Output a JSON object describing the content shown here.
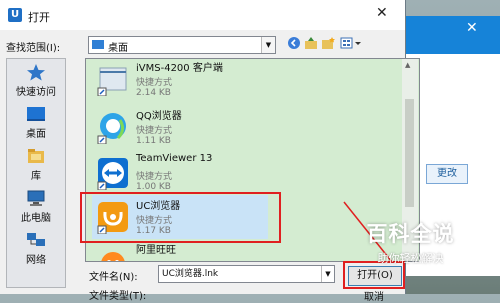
{
  "dialog": {
    "title": "打开",
    "app_icon_letter": "U",
    "close_label": "✕"
  },
  "look_in": {
    "label": "查找范围(I):",
    "value": "桌面"
  },
  "places": [
    {
      "label": "快速访问",
      "icon": "star-icon"
    },
    {
      "label": "桌面",
      "icon": "desktop-icon"
    },
    {
      "label": "库",
      "icon": "library-icon"
    },
    {
      "label": "此电脑",
      "icon": "computer-icon"
    },
    {
      "label": "网络",
      "icon": "network-icon"
    }
  ],
  "files": [
    {
      "name": "iVMS-4200 客户端",
      "type": "快捷方式",
      "size": "2.14 KB",
      "icon": "ivms-icon"
    },
    {
      "name": "QQ浏览器",
      "type": "快捷方式",
      "size": "1.11 KB",
      "icon": "qq-browser-icon"
    },
    {
      "name": "TeamViewer 13",
      "type": "快捷方式",
      "size": "1.00 KB",
      "icon": "teamviewer-icon"
    },
    {
      "name": "UC浏览器",
      "type": "快捷方式",
      "size": "1.17 KB",
      "icon": "uc-browser-icon",
      "selected": true
    },
    {
      "name": "阿里旺旺",
      "type": "",
      "size": "",
      "icon": "aliwangwang-icon"
    }
  ],
  "file_name": {
    "label": "文件名(N):",
    "value": "UC浏览器.lnk"
  },
  "file_type": {
    "label": "文件类型(T):"
  },
  "buttons": {
    "open": "打开(O)",
    "cancel": "取消"
  },
  "background_app": {
    "change_button": "更改",
    "close_label": "✕"
  },
  "watermark": {
    "title": "百科全说",
    "subtitle": "助你轻松解决"
  },
  "colors": {
    "list_bg": "#d4ecd1",
    "highlight_frame": "#e02020",
    "accent": "#1683d8"
  }
}
